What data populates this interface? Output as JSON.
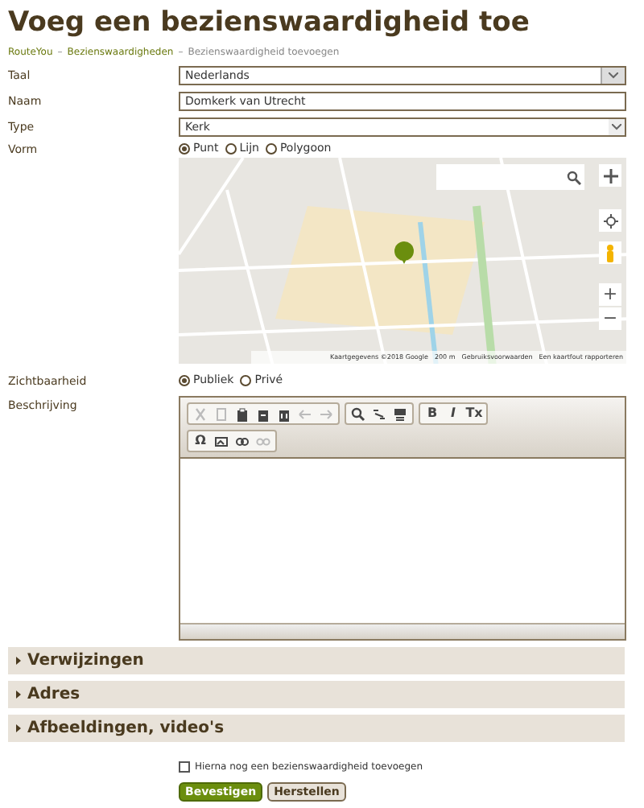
{
  "title": "Voeg een bezienswaardigheid toe",
  "breadcrumb": [
    {
      "label": "RouteYou",
      "link": true
    },
    {
      "label": "Bezienswaardigheden",
      "link": true
    },
    {
      "label": "Bezienswaardigheid toevoegen",
      "link": false
    }
  ],
  "breadcrumb_separators": [
    "–",
    "–"
  ],
  "fields": [
    {
      "label": "Taal",
      "kind": "select",
      "value": "Nederlands"
    },
    {
      "label": "Naam",
      "kind": "text",
      "value": "Domkerk van Utrecht"
    },
    {
      "label": "Type",
      "kind": "select-small",
      "value": "Kerk"
    }
  ],
  "shape": {
    "label": "Vorm",
    "options": [
      {
        "label": "Punt",
        "selected": true
      },
      {
        "label": "Lijn",
        "selected": false
      },
      {
        "label": "Polygoon",
        "selected": false
      }
    ]
  },
  "map": {
    "attribution": [
      "Kaartgegevens ©2018 Google",
      "200 m",
      "Gebruiksvoorwaarden",
      "Een kaartfout rapporteren"
    ],
    "zoom_in": "+",
    "zoom_out": "−"
  },
  "visibility": {
    "label": "Zichtbaarheid",
    "options": [
      {
        "label": "Publiek",
        "selected": true
      },
      {
        "label": "Privé",
        "selected": false
      }
    ]
  },
  "description": {
    "label": "Beschrijving",
    "toolbar": [
      [
        [
          {
            "kind": "cut",
            "disabled": true
          },
          {
            "kind": "copy",
            "disabled": true
          },
          {
            "kind": "paste",
            "disabled": false
          },
          {
            "kind": "paste-text",
            "disabled": false
          },
          {
            "kind": "paste-word",
            "disabled": false
          },
          {
            "kind": "undo",
            "disabled": true
          },
          {
            "kind": "redo",
            "disabled": true
          }
        ],
        [
          {
            "kind": "find",
            "disabled": false
          },
          {
            "kind": "replace",
            "disabled": false
          },
          {
            "kind": "template",
            "disabled": false
          }
        ],
        [
          {
            "kind": "bold",
            "glyph": "B",
            "disabled": false
          },
          {
            "kind": "italic",
            "glyph": "I",
            "disabled": false
          },
          {
            "kind": "clear-format",
            "glyph": "Tx",
            "disabled": false
          }
        ]
      ],
      [
        [
          {
            "kind": "special-char",
            "glyph": "Ω",
            "disabled": false
          },
          {
            "kind": "image",
            "disabled": false
          },
          {
            "kind": "link",
            "disabled": false
          },
          {
            "kind": "unlink",
            "disabled": true
          }
        ]
      ]
    ]
  },
  "sections": [
    {
      "label": "Verwijzingen",
      "expanded": false
    },
    {
      "label": "Adres",
      "expanded": false
    },
    {
      "label": "Afbeeldingen, video's",
      "expanded": false
    }
  ],
  "add_another": {
    "label": "Hierna nog een bezienswaardigheid toevoegen",
    "checked": false
  },
  "buttons": [
    {
      "label": "Bevestigen",
      "kind": "primary"
    },
    {
      "label": "Herstellen",
      "kind": "secondary"
    }
  ]
}
